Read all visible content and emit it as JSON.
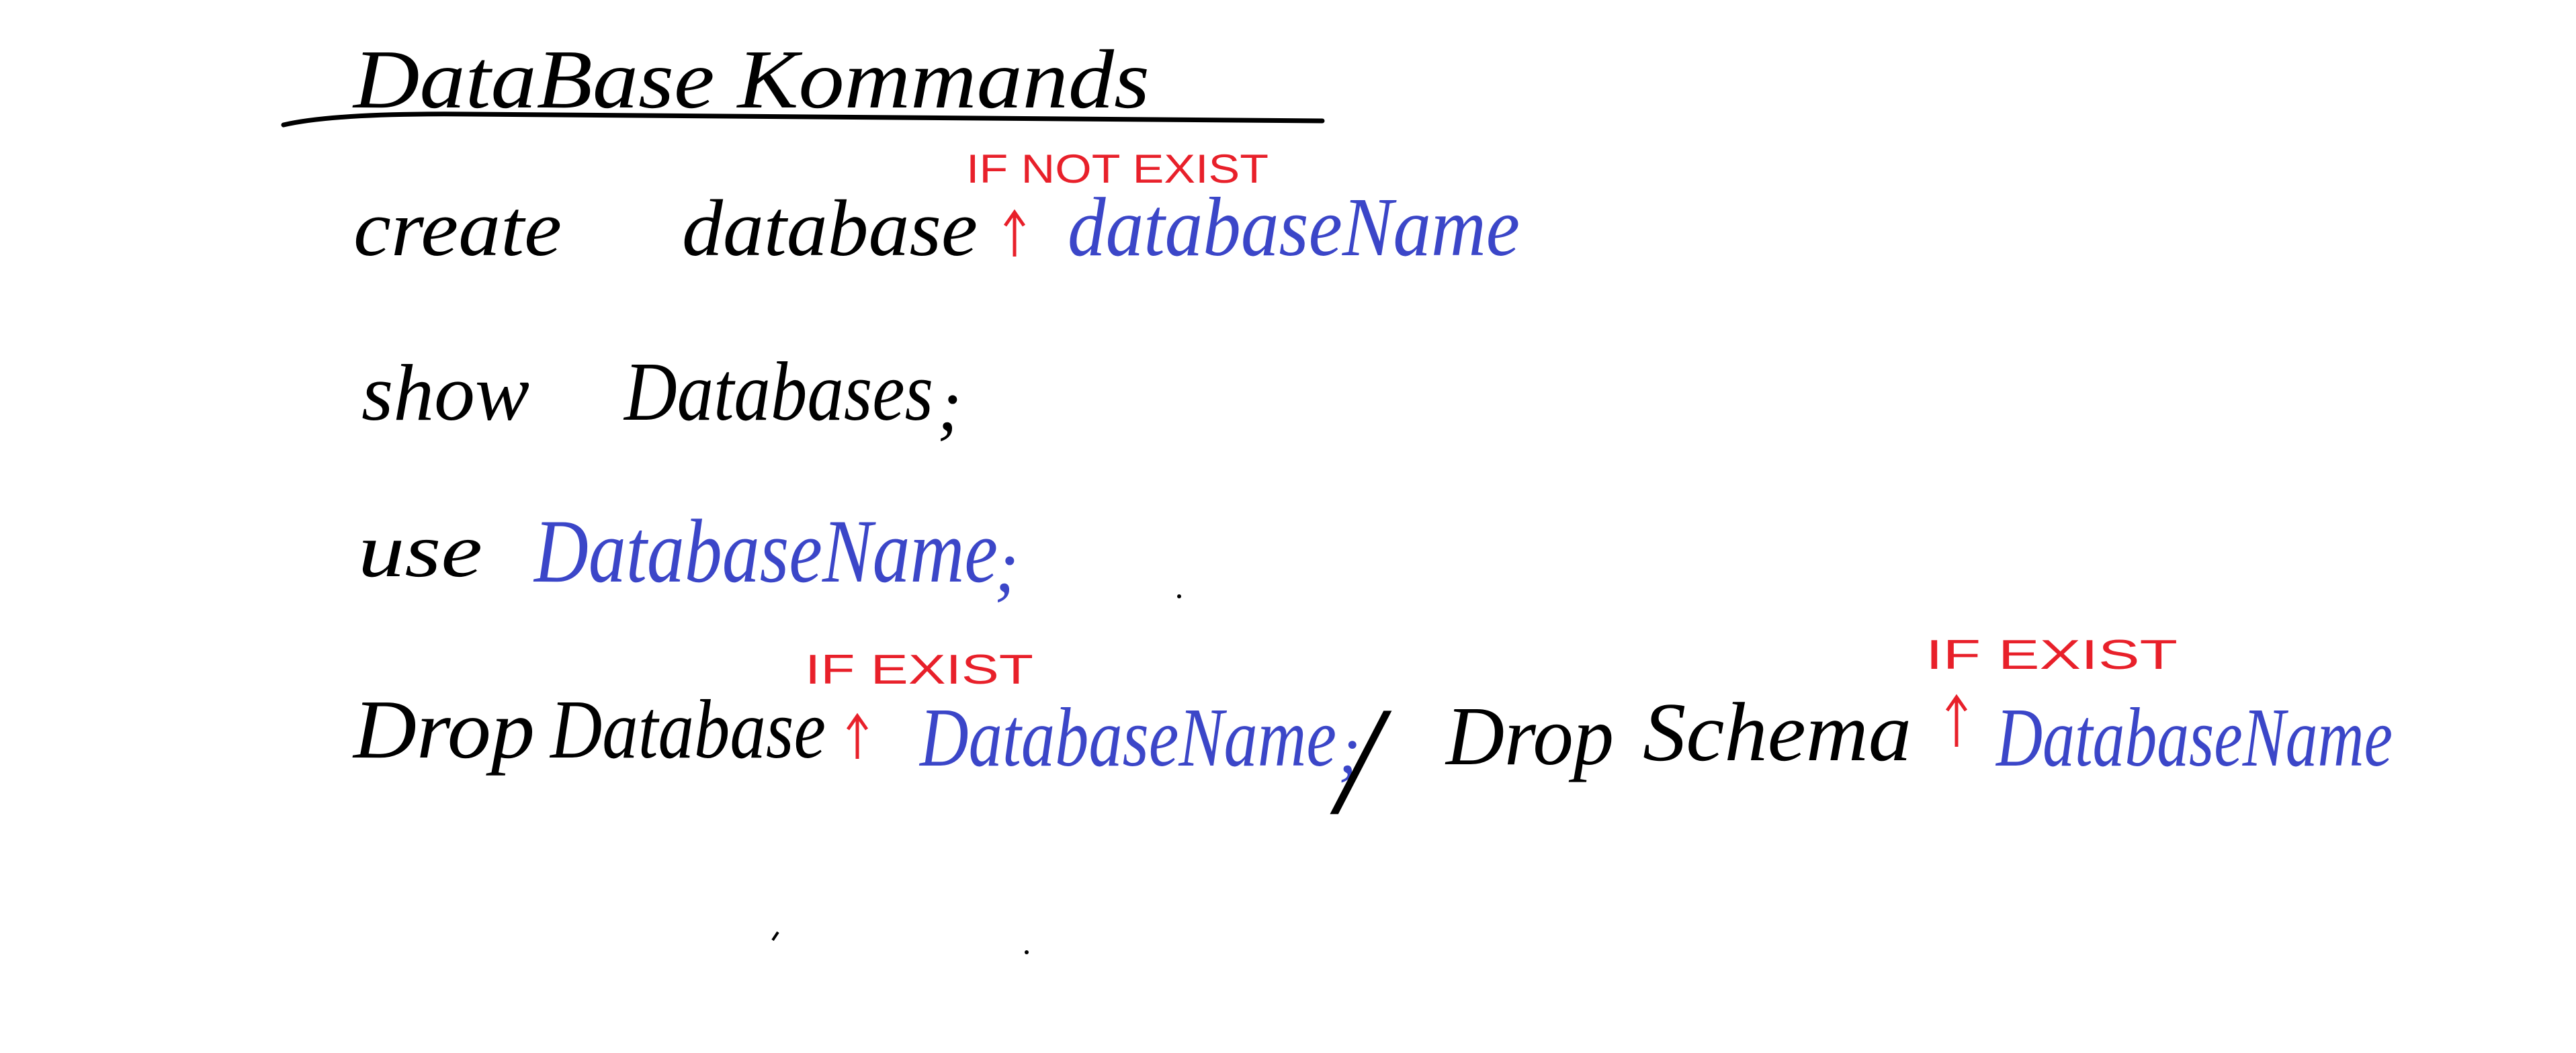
{
  "title": "DataBase Kommands",
  "colors": {
    "ink": "#000000",
    "placeholder": "#3b46c8",
    "annotation": "#e8202a"
  },
  "lines": {
    "create": {
      "keyword1": "create",
      "keyword2": "database",
      "option": "IF NOT EXIST",
      "name": "databaseName"
    },
    "show": {
      "keyword1": "show",
      "keyword2": "Databases",
      "terminator": ";"
    },
    "use": {
      "keyword1": "use",
      "name": "DatabaseName",
      "terminator": ";"
    },
    "drop": {
      "keyword1": "Drop",
      "keyword2": "Database",
      "option": "IF EXIST",
      "name": "DatabaseName",
      "terminator": ";",
      "separator": "/",
      "alt_keyword1": "Drop",
      "alt_keyword2": "Schema",
      "alt_option": "IF EXIST",
      "alt_name": "DatabaseName"
    }
  }
}
